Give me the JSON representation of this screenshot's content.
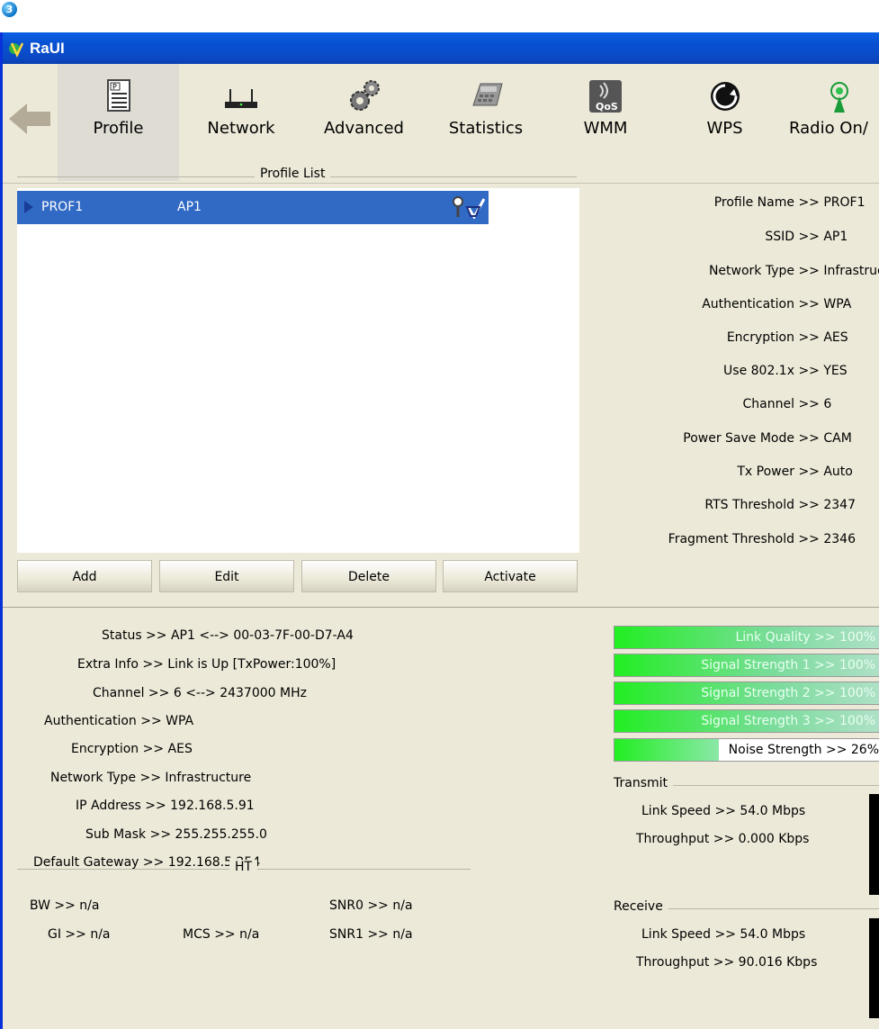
{
  "badge": "3",
  "window": {
    "title": "RaUI"
  },
  "toolbar": {
    "items": [
      {
        "label": "Profile",
        "icon": "profile-icon"
      },
      {
        "label": "Network",
        "icon": "network-icon"
      },
      {
        "label": "Advanced",
        "icon": "advanced-icon"
      },
      {
        "label": "Statistics",
        "icon": "statistics-icon"
      },
      {
        "label": "WMM",
        "icon": "wmm-icon"
      },
      {
        "label": "WPS",
        "icon": "wps-icon"
      },
      {
        "label": "Radio On/",
        "icon": "radio-icon"
      }
    ],
    "wmm_badge": "QoS"
  },
  "profile_list": {
    "legend": "Profile List",
    "rows": [
      {
        "name": "PROF1",
        "ssid": "AP1"
      }
    ],
    "buttons": {
      "add": "Add",
      "edit": "Edit",
      "delete": "Delete",
      "activate": "Activate"
    }
  },
  "profile_details": [
    {
      "label": "Profile Name >> PROF1"
    },
    {
      "label": "SSID >> AP1"
    },
    {
      "label": "Network Type >> Infrastructure"
    },
    {
      "label": "Authentication >> WPA"
    },
    {
      "label": "Encryption >> AES"
    },
    {
      "label": "Use 802.1x >> YES"
    },
    {
      "label": "Channel >> 6"
    },
    {
      "label": "Power Save Mode >> CAM"
    },
    {
      "label": "Tx Power >> Auto"
    },
    {
      "label": "RTS Threshold >> 2347"
    },
    {
      "label": "Fragment Threshold >> 2346"
    }
  ],
  "status": {
    "status": "Status >> AP1 <--> 00-03-7F-00-D7-A4",
    "extra_info": "Extra Info >> Link is Up [TxPower:100%]",
    "channel": "Channel >> 6 <--> 2437000 MHz",
    "authentication": "Authentication >> WPA",
    "encryption": "Encryption >> AES",
    "network_type": "Network Type >> Infrastructure",
    "ip_address": "IP Address >> 192.168.5.91",
    "sub_mask": "Sub Mask >> 255.255.255.0",
    "default_gateway": "Default Gateway >> 192.168.5.254"
  },
  "ht": {
    "legend": "HT",
    "bw": "BW >> n/a",
    "gi": "GI >> n/a",
    "mcs": "MCS >> n/a",
    "snr0": "SNR0 >> n/a",
    "snr1": "SNR1 >> n/a"
  },
  "signal": {
    "link_quality": {
      "text": "Link Quality >> 100%",
      "level": 1.0
    },
    "signal_strength_1": {
      "text": "Signal Strength 1 >> 100%",
      "level": 1.0
    },
    "signal_strength_2": {
      "text": "Signal Strength 2 >> 100%",
      "level": 1.0
    },
    "signal_strength_3": {
      "text": "Signal Strength 3 >> 100%",
      "level": 1.0
    },
    "noise_strength": {
      "text": "Noise Strength >> 26%",
      "level": 0.26
    }
  },
  "transmit": {
    "legend": "Transmit",
    "link_speed": "Link Speed >> 54.0 Mbps",
    "throughput": "Throughput >> 0.000 Kbps"
  },
  "receive": {
    "legend": "Receive",
    "link_speed": "Link Speed >> 54.0 Mbps",
    "throughput": "Throughput >> 90.016 Kbps"
  },
  "colors": {
    "titlebar": "#0a5fe3",
    "selection": "#316ac5",
    "window_bg": "#ece9d8",
    "bar_green": "#22ee22"
  }
}
